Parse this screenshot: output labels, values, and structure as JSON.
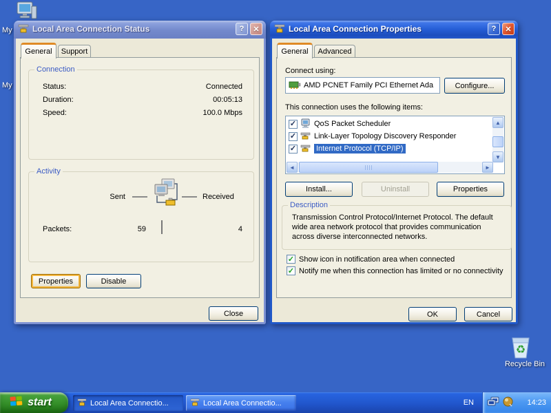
{
  "desktop": {
    "partial_icon_labels": [
      "My",
      "My"
    ],
    "recycle_bin_label": "Recycle Bin"
  },
  "icons": {
    "help_glyph": "?",
    "close_glyph": "✕"
  },
  "status_window": {
    "title": "Local Area Connection Status",
    "tabs": [
      "General",
      "Support"
    ],
    "connection": {
      "label": "Connection",
      "rows": [
        {
          "label": "Status:",
          "value": "Connected"
        },
        {
          "label": "Duration:",
          "value": "00:05:13"
        },
        {
          "label": "Speed:",
          "value": "100.0 Mbps"
        }
      ]
    },
    "activity": {
      "label": "Activity",
      "sent_label": "Sent",
      "received_label": "Received",
      "packets_label": "Packets:",
      "packets_sent": "59",
      "packets_received": "4"
    },
    "properties_button": "Properties",
    "disable_button": "Disable",
    "close_button": "Close"
  },
  "properties_window": {
    "title": "Local Area Connection Properties",
    "tabs": [
      "General",
      "Advanced"
    ],
    "connect_using_label": "Connect using:",
    "adapter_name": "AMD PCNET Family PCI Ethernet Ada",
    "configure_button": "Configure...",
    "items_label": "This connection uses the following items:",
    "items": [
      {
        "label": "QoS Packet Scheduler"
      },
      {
        "label": "Link-Layer Topology Discovery Responder"
      },
      {
        "label": "Internet Protocol (TCP/IP)"
      }
    ],
    "install_button": "Install...",
    "uninstall_button": "Uninstall",
    "item_properties_button": "Properties",
    "description": {
      "label": "Description",
      "text": "Transmission Control Protocol/Internet Protocol. The default wide area network protocol that provides communication across diverse interconnected networks."
    },
    "checkbox_labels": [
      "Show icon in notification area when connected",
      "Notify me when this connection has limited or no connectivity"
    ],
    "ok_button": "OK",
    "cancel_button": "Cancel"
  },
  "taskbar": {
    "start_label": "start",
    "buttons": [
      "Local Area Connectio...",
      "Local Area Connectio..."
    ],
    "language_indicator": "EN",
    "time": "14:23"
  },
  "colors": {
    "desktop": "#3765C6",
    "selection": "#316AC5",
    "dialog_face": "#ECE9D8",
    "active_tab_accent": "#E08A26"
  }
}
